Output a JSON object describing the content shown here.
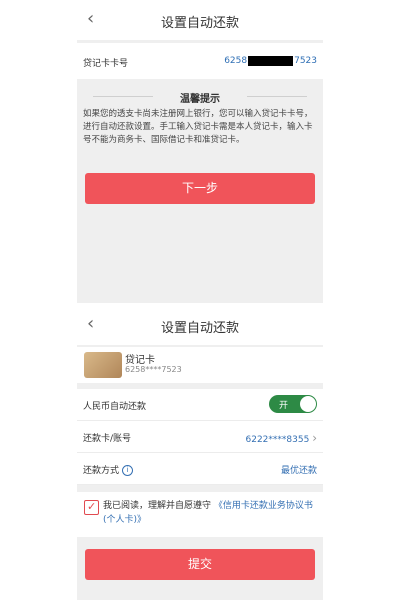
{
  "screen1": {
    "nav": {
      "back_icon": "‹",
      "title": "设置自动还款"
    },
    "card_row": {
      "label": "贷记卡卡号",
      "number_prefix": "6258",
      "number_suffix": "7523"
    },
    "tip": {
      "title": "温馨提示",
      "text": "如果您的透支卡尚未注册网上银行，您可以输入贷记卡卡号，进行自动还款设置。手工输入贷记卡需是本人贷记卡，输入卡号不能为商务卡、国际借记卡和准贷记卡。"
    },
    "next_button": "下一步"
  },
  "screen2": {
    "nav": {
      "back_icon": "‹",
      "title": "设置自动还款"
    },
    "card": {
      "name": "贷记卡",
      "number": "6258****7523"
    },
    "rmb_auto": {
      "label": "人民币自动还款",
      "toggle_label": "开",
      "on": true
    },
    "repay_card": {
      "label": "还款卡/账号",
      "value": "6222****8355",
      "chevron": "›"
    },
    "repay_method": {
      "label": "还款方式",
      "info_icon": "i",
      "value": "最优还款"
    },
    "agreement": {
      "checked": true,
      "prefix": "我已阅读，理解并自愿遵守",
      "link": "《信用卡还款业务协议书(个人卡)》"
    },
    "submit_button": "提交"
  },
  "colors": {
    "accent_red": "#f0545a",
    "link_blue": "#3570b3",
    "toggle_green": "#2d8a45"
  }
}
